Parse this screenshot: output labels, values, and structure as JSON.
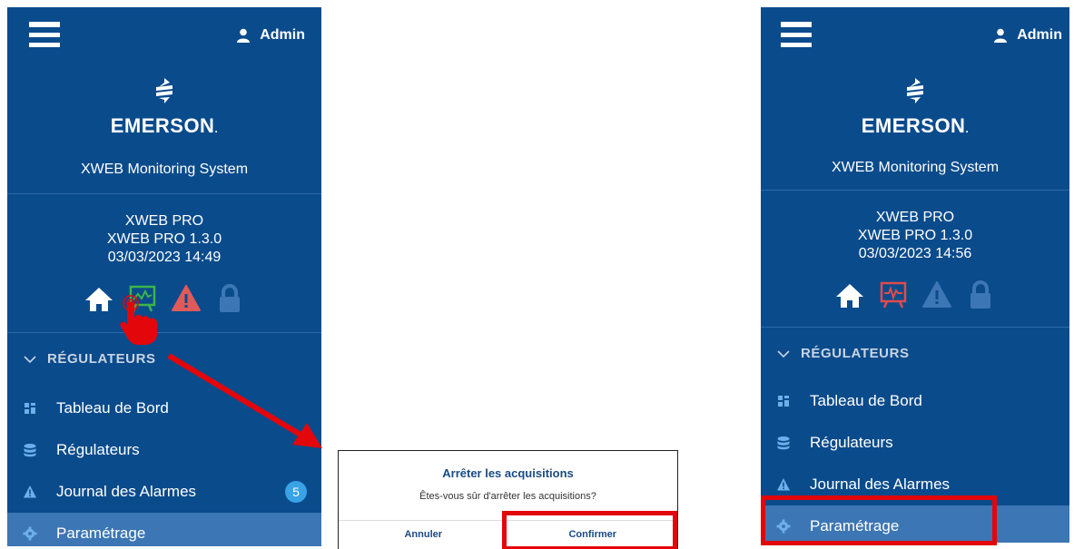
{
  "left": {
    "user": "Admin",
    "brand": "EMERSON",
    "brand_dot": ".",
    "system": "XWEB Monitoring System",
    "device_line1": "XWEB PRO",
    "device_line2": "XWEB PRO 1.3.0",
    "datetime": "03/03/2023 14:49",
    "section": "RÉGULATEURS",
    "menu": [
      {
        "label": "Tableau de Bord"
      },
      {
        "label": "Régulateurs"
      },
      {
        "label": "Journal des Alarmes",
        "badge": "5"
      },
      {
        "label": "Paramétrage"
      }
    ]
  },
  "right": {
    "user": "Admin",
    "brand": "EMERSON",
    "brand_dot": ".",
    "system": "XWEB Monitoring System",
    "device_line1": "XWEB PRO",
    "device_line2": "XWEB PRO 1.3.0",
    "datetime": "03/03/2023 14:56",
    "section": "RÉGULATEURS",
    "menu": [
      {
        "label": "Tableau de Bord"
      },
      {
        "label": "Régulateurs"
      },
      {
        "label": "Journal des Alarmes"
      },
      {
        "label": "Paramétrage"
      }
    ]
  },
  "dialog": {
    "title": "Arrêter les acquisitions",
    "message": "Êtes-vous sûr d'arrêter les acquisitions?",
    "cancel": "Annuler",
    "confirm": "Confirmer"
  },
  "colors": {
    "panel_bg": "#0a4b8c",
    "active_item": "#3c76b4",
    "badge": "#3aa2e6",
    "alarm": "#e05a5a",
    "acquisition_on": "#3bb54a",
    "acquisition_off": "#e14b4b",
    "highlight": "#e3060b"
  },
  "icons": [
    "menu-icon",
    "user-icon",
    "emerson-logo-icon",
    "home-icon",
    "acquisition-icon",
    "alarm-icon",
    "lock-icon",
    "chevron-down-icon",
    "dashboard-icon",
    "database-icon",
    "warning-icon",
    "gear-icon",
    "hand-pointer-icon"
  ]
}
